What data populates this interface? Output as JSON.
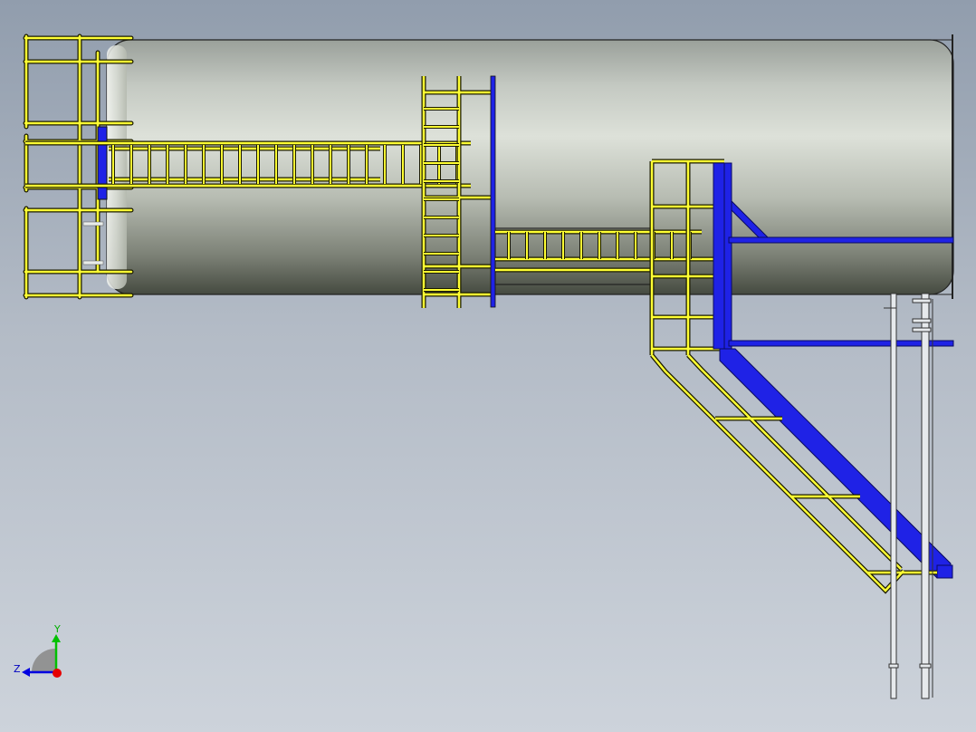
{
  "viewport": {
    "background_top": "#919dad",
    "background_bottom": "#cdd3db"
  },
  "model": {
    "vessel_color": "#c8cdc6",
    "ladder_color": "#ffff33",
    "steel_color": "#1f22e6"
  },
  "triad": {
    "y_label": "Y",
    "z_label": "Z",
    "x_axis_color": "#e60000",
    "y_axis_color": "#00c000",
    "z_axis_color": "#0000e0"
  }
}
